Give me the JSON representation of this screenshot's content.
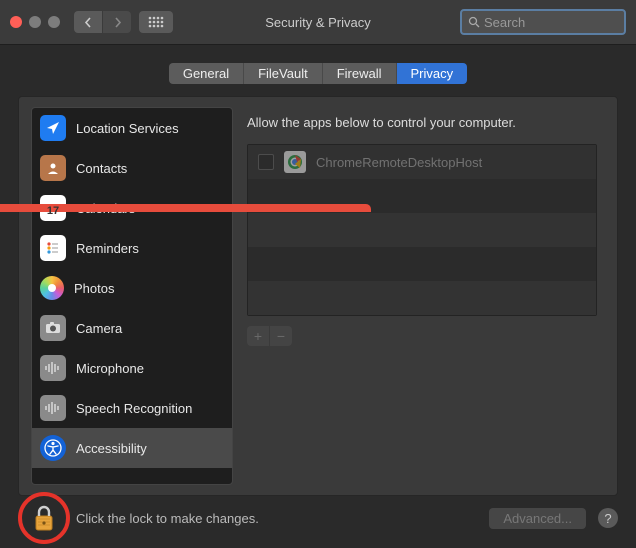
{
  "window": {
    "title": "Security & Privacy"
  },
  "search": {
    "placeholder": "Search"
  },
  "tabs": [
    {
      "label": "General",
      "active": false
    },
    {
      "label": "FileVault",
      "active": false
    },
    {
      "label": "Firewall",
      "active": false
    },
    {
      "label": "Privacy",
      "active": true
    }
  ],
  "sidebar": {
    "items": [
      {
        "label": "Location Services",
        "icon": "location",
        "selected": false
      },
      {
        "label": "Contacts",
        "icon": "contacts",
        "selected": false
      },
      {
        "label": "Calendars",
        "icon": "calendar",
        "selected": false
      },
      {
        "label": "Reminders",
        "icon": "reminders",
        "selected": false
      },
      {
        "label": "Photos",
        "icon": "photos",
        "selected": false
      },
      {
        "label": "Camera",
        "icon": "camera",
        "selected": false
      },
      {
        "label": "Microphone",
        "icon": "microphone",
        "selected": false
      },
      {
        "label": "Speech Recognition",
        "icon": "speech",
        "selected": false
      },
      {
        "label": "Accessibility",
        "icon": "accessibility",
        "selected": true
      }
    ]
  },
  "main": {
    "description": "Allow the apps below to control your computer.",
    "apps": [
      {
        "name": "ChromeRemoteDesktopHost",
        "checked": false,
        "enabled": false
      }
    ]
  },
  "footer": {
    "lock_text": "Click the lock to make changes.",
    "advanced_label": "Advanced...",
    "help_label": "?"
  },
  "colors": {
    "close": "#ff5f57",
    "minimize": "#7d7d7d",
    "zoom": "#7d7d7d",
    "accent": "#3173d6",
    "highlight_ring": "#e5332a"
  }
}
